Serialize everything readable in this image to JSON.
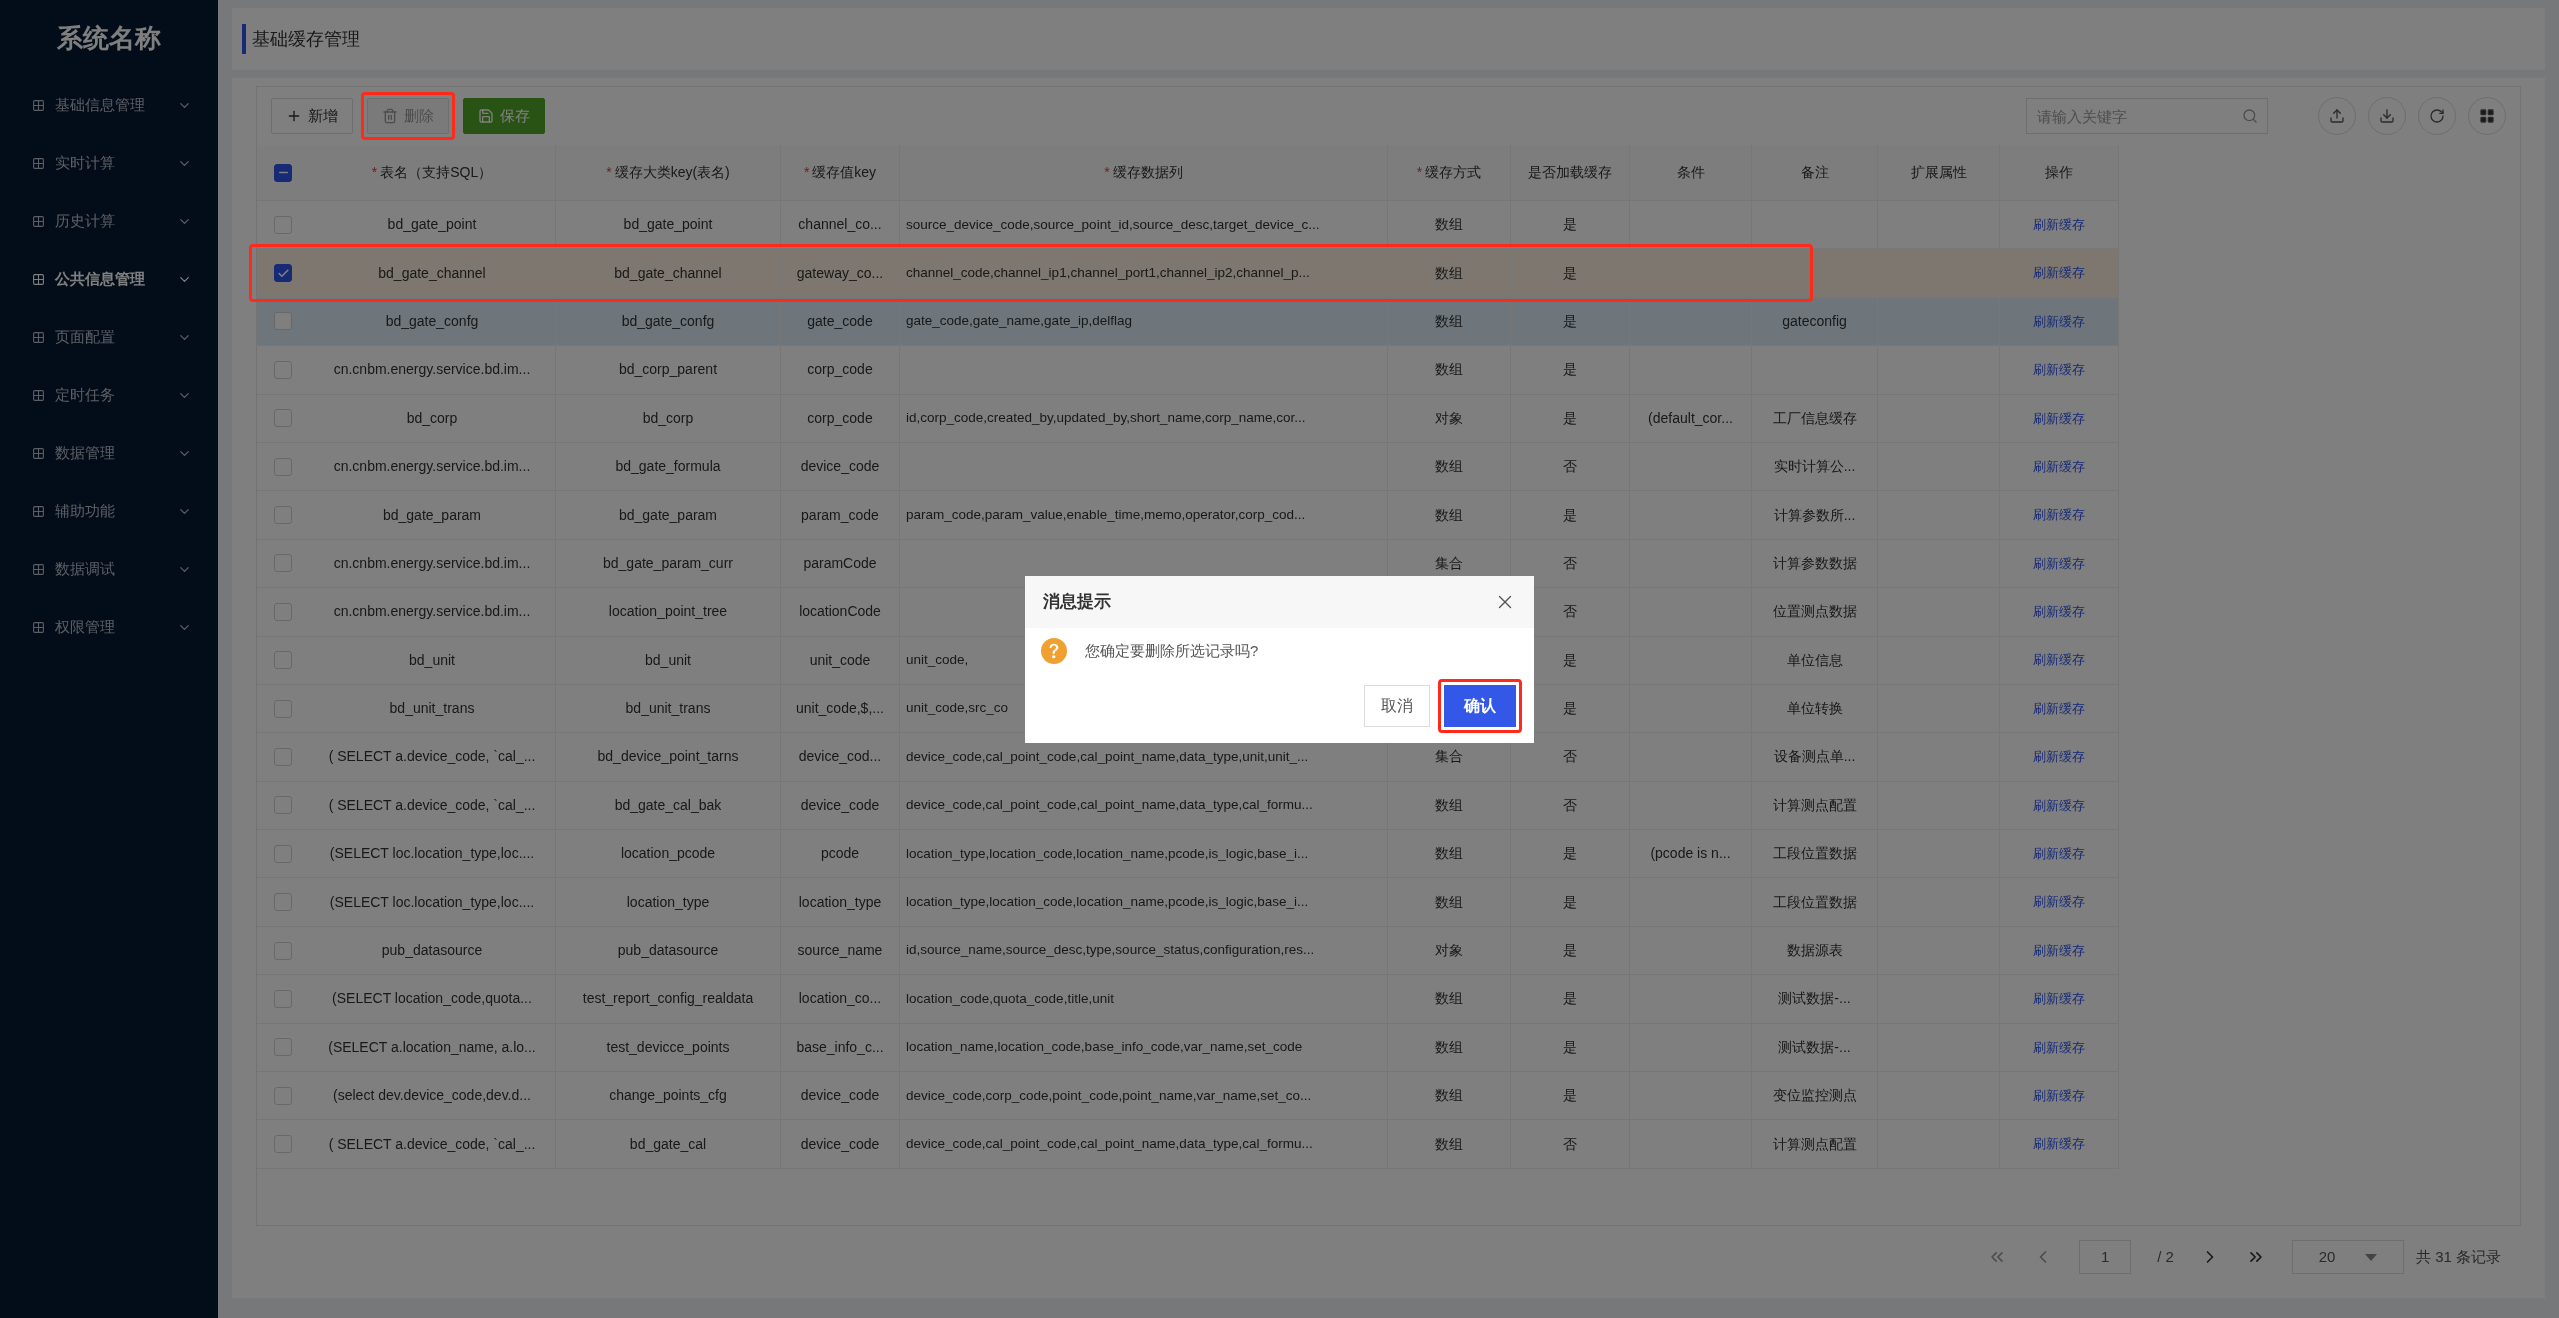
{
  "sidebar": {
    "title": "系统名称",
    "items": [
      {
        "label": "基础信息管理",
        "selected": false
      },
      {
        "label": "实时计算",
        "selected": false
      },
      {
        "label": "历史计算",
        "selected": false
      },
      {
        "label": "公共信息管理",
        "selected": true
      },
      {
        "label": "页面配置",
        "selected": false
      },
      {
        "label": "定时任务",
        "selected": false
      },
      {
        "label": "数据管理",
        "selected": false
      },
      {
        "label": "辅助功能",
        "selected": false
      },
      {
        "label": "数据调试",
        "selected": false
      },
      {
        "label": "权限管理",
        "selected": false
      }
    ]
  },
  "page_title": "基础缓存管理",
  "toolbar": {
    "buttons": [
      {
        "label": "新增",
        "kind": "add",
        "outlined": false
      },
      {
        "label": "删除",
        "kind": "delete",
        "outlined": true
      },
      {
        "label": "保存",
        "kind": "save",
        "outlined": false
      }
    ],
    "search": {
      "placeholder": "请输入关键字"
    }
  },
  "table": {
    "select_all": {
      "partial": true
    },
    "columns": [
      {
        "label": "表名（支持SQL）",
        "required_mark": "*"
      },
      {
        "label": "缓存大类key(表名)",
        "required_mark": "*"
      },
      {
        "label": "缓存值key",
        "required_mark": "*"
      },
      {
        "label": "缓存数据列",
        "required_mark": "*"
      },
      {
        "label": "缓存方式",
        "required_mark": "*"
      },
      {
        "label": "是否加载缓存"
      },
      {
        "label": "条件"
      },
      {
        "label": "备注"
      },
      {
        "label": "扩展属性"
      },
      {
        "label": "操作"
      }
    ],
    "rows": [
      {
        "checked": false,
        "highlighted": false,
        "outlined": false,
        "table_name": "bd_gate_point",
        "cache_key": "bd_gate_point",
        "value_key": "channel_co...",
        "data_columns": "source_device_code,source_point_id,source_desc,target_device_c...",
        "mode": "数组",
        "load": "是",
        "action": "刷新缓存"
      },
      {
        "checked": true,
        "highlighted": false,
        "outlined": true,
        "table_name": "bd_gate_channel",
        "cache_key": "bd_gate_channel",
        "value_key": "gateway_co...",
        "data_columns": "channel_code,channel_ip1,channel_port1,channel_ip2,channel_p...",
        "mode": "数组",
        "load": "是",
        "action": "刷新缓存"
      },
      {
        "checked": false,
        "highlighted": true,
        "outlined": false,
        "table_name": "bd_gate_confg",
        "cache_key": "bd_gate_confg",
        "value_key": "gate_code",
        "data_columns": "gate_code,gate_name,gate_ip,delflag",
        "mode": "数组",
        "load": "是",
        "note": "gateconfig",
        "action": "刷新缓存"
      },
      {
        "checked": false,
        "highlighted": false,
        "outlined": false,
        "table_name": "cn.cnbm.energy.service.bd.im...",
        "cache_key": "bd_corp_parent",
        "value_key": "corp_code",
        "mode": "数组",
        "load": "是",
        "action": "刷新缓存"
      },
      {
        "checked": false,
        "highlighted": false,
        "outlined": false,
        "table_name": "bd_corp",
        "cache_key": "bd_corp",
        "value_key": "corp_code",
        "data_columns": "id,corp_code,created_by,updated_by,short_name,corp_name,cor...",
        "mode": "对象",
        "load": "是",
        "condition": "(default_cor...",
        "note": "工厂信息缓存",
        "action": "刷新缓存"
      },
      {
        "checked": false,
        "highlighted": false,
        "outlined": false,
        "table_name": "cn.cnbm.energy.service.bd.im...",
        "cache_key": "bd_gate_formula",
        "value_key": "device_code",
        "mode": "数组",
        "load": "否",
        "note": "实时计算公...",
        "action": "刷新缓存"
      },
      {
        "checked": false,
        "highlighted": false,
        "outlined": false,
        "table_name": "bd_gate_param",
        "cache_key": "bd_gate_param",
        "value_key": "param_code",
        "data_columns": "param_code,param_value,enable_time,memo,operator,corp_cod...",
        "mode": "数组",
        "load": "是",
        "note": "计算参数所...",
        "action": "刷新缓存"
      },
      {
        "checked": false,
        "highlighted": false,
        "outlined": false,
        "table_name": "cn.cnbm.energy.service.bd.im...",
        "cache_key": "bd_gate_param_curr",
        "value_key": "paramCode",
        "mode": "集合",
        "load": "否",
        "note": "计算参数数据",
        "action": "刷新缓存"
      },
      {
        "checked": false,
        "highlighted": false,
        "outlined": false,
        "table_name": "cn.cnbm.energy.service.bd.im...",
        "cache_key": "location_point_tree",
        "value_key": "locationCode",
        "load": "否",
        "note": "位置测点数据",
        "action": "刷新缓存"
      },
      {
        "checked": false,
        "highlighted": false,
        "outlined": false,
        "table_name": "bd_unit",
        "cache_key": "bd_unit",
        "value_key": "unit_code",
        "data_columns": "unit_code,",
        "load": "是",
        "note": "单位信息",
        "action": "刷新缓存"
      },
      {
        "checked": false,
        "highlighted": false,
        "outlined": false,
        "table_name": "bd_unit_trans",
        "cache_key": "bd_unit_trans",
        "value_key": "unit_code,$,...",
        "data_columns": "unit_code,src_co",
        "load": "是",
        "note": "单位转换",
        "action": "刷新缓存"
      },
      {
        "checked": false,
        "highlighted": false,
        "outlined": false,
        "table_name": "( SELECT a.device_code, `cal_...",
        "cache_key": "bd_device_point_tarns",
        "value_key": "device_cod...",
        "data_columns": "device_code,cal_point_code,cal_point_name,data_type,unit,unit_...",
        "mode": "集合",
        "load": "否",
        "note": "设备测点单...",
        "action": "刷新缓存"
      },
      {
        "checked": false,
        "highlighted": false,
        "outlined": false,
        "table_name": "( SELECT a.device_code, `cal_...",
        "cache_key": "bd_gate_cal_bak",
        "value_key": "device_code",
        "data_columns": "device_code,cal_point_code,cal_point_name,data_type,cal_formu...",
        "mode": "数组",
        "load": "否",
        "note": "计算测点配置",
        "action": "刷新缓存"
      },
      {
        "checked": false,
        "highlighted": false,
        "outlined": false,
        "table_name": "(SELECT loc.location_type,loc....",
        "cache_key": "location_pcode",
        "value_key": "pcode",
        "data_columns": "location_type,location_code,location_name,pcode,is_logic,base_i...",
        "mode": "数组",
        "load": "是",
        "condition": "(pcode is n...",
        "note": "工段位置数据",
        "action": "刷新缓存"
      },
      {
        "checked": false,
        "highlighted": false,
        "outlined": false,
        "table_name": "(SELECT loc.location_type,loc....",
        "cache_key": "location_type",
        "value_key": "location_type",
        "data_columns": "location_type,location_code,location_name,pcode,is_logic,base_i...",
        "mode": "数组",
        "load": "是",
        "note": "工段位置数据",
        "action": "刷新缓存"
      },
      {
        "checked": false,
        "highlighted": false,
        "outlined": false,
        "table_name": "pub_datasource",
        "cache_key": "pub_datasource",
        "value_key": "source_name",
        "data_columns": "id,source_name,source_desc,type,source_status,configuration,res...",
        "mode": "对象",
        "load": "是",
        "note": "数据源表",
        "action": "刷新缓存"
      },
      {
        "checked": false,
        "highlighted": false,
        "outlined": false,
        "table_name": "(SELECT location_code,quota...",
        "cache_key": "test_report_config_realdata",
        "value_key": "location_co...",
        "data_columns": "location_code,quota_code,title,unit",
        "mode": "数组",
        "load": "是",
        "note": "测试数据-...",
        "action": "刷新缓存"
      },
      {
        "checked": false,
        "highlighted": false,
        "outlined": false,
        "table_name": "(SELECT a.location_name, a.lo...",
        "cache_key": "test_devicce_points",
        "value_key": "base_info_c...",
        "data_columns": "location_name,location_code,base_info_code,var_name,set_code",
        "mode": "数组",
        "load": "是",
        "note": "测试数据-...",
        "action": "刷新缓存"
      },
      {
        "checked": false,
        "highlighted": false,
        "outlined": false,
        "table_name": "(select dev.device_code,dev.d...",
        "cache_key": "change_points_cfg",
        "value_key": "device_code",
        "data_columns": "device_code,corp_code,point_code,point_name,var_name,set_co...",
        "mode": "数组",
        "load": "是",
        "note": "变位监控测点",
        "action": "刷新缓存"
      },
      {
        "checked": false,
        "highlighted": false,
        "outlined": false,
        "table_name": "( SELECT a.device_code, `cal_...",
        "cache_key": "bd_gate_cal",
        "value_key": "device_code",
        "data_columns": "device_code,cal_point_code,cal_point_name,data_type,cal_formu...",
        "mode": "数组",
        "load": "否",
        "note": "计算测点配置",
        "action": "刷新缓存"
      }
    ]
  },
  "pagination": {
    "page": "1",
    "total_pages": "/ 2",
    "page_size": "20",
    "total": "共 31 条记录"
  },
  "dialog": {
    "title": "消息提示",
    "message": "您确定要删除所选记录吗?",
    "buttons": [
      {
        "label": "取消",
        "kind": "secondary",
        "outlined": false
      },
      {
        "label": "确认",
        "kind": "primary",
        "outlined": true
      }
    ]
  }
}
